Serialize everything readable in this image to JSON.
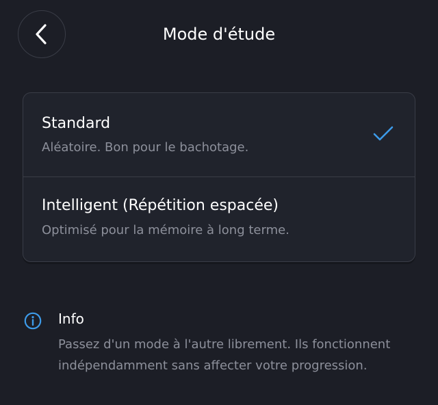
{
  "header": {
    "back_icon": "chevron-left-icon",
    "title": "Mode d'étude"
  },
  "modes": [
    {
      "title": "Standard",
      "description": "Aléatoire. Bon pour le bachotage.",
      "selected": true
    },
    {
      "title": "Intelligent (Répétition espacée)",
      "description": "Optimisé pour la mémoire à long terme.",
      "selected": false
    }
  ],
  "info": {
    "icon": "info-icon",
    "title": "Info",
    "text": "Passez d'un mode à l'autre librement. Ils fonctionnent indépendamment sans affecter votre progression."
  },
  "colors": {
    "background": "#1c1e26",
    "card": "#20232c",
    "border": "#3a3d47",
    "accent": "#3d9be9",
    "secondary_text": "#8d909b"
  }
}
